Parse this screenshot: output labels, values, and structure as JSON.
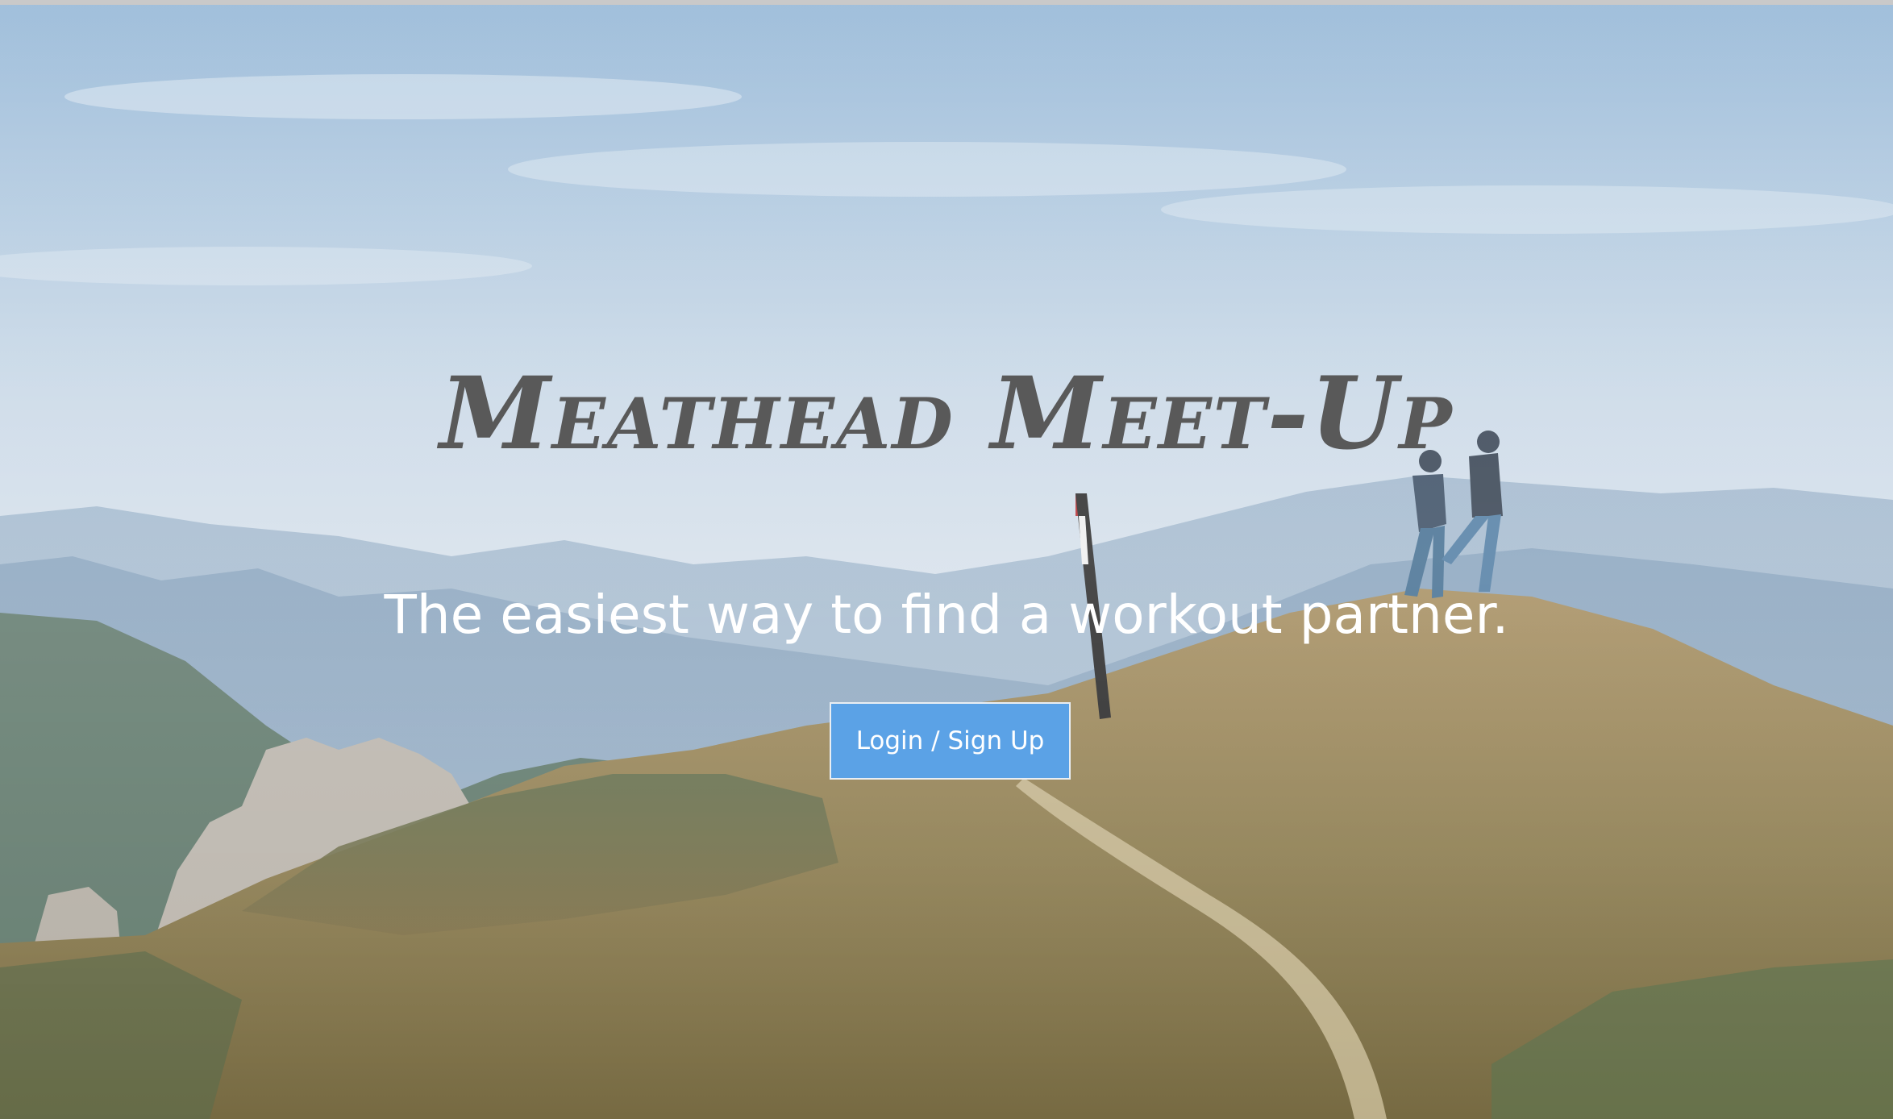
{
  "hero": {
    "title": "Meathead Meet-Up",
    "tagline": "The easiest way to find a workout partner.",
    "cta_label": "Login / Sign Up",
    "background": "mountain-hikers-photo"
  },
  "colors": {
    "title": "#595959",
    "tagline": "#ffffff",
    "cta_background": "#5ba2e6",
    "cta_text": "#ffffff"
  }
}
